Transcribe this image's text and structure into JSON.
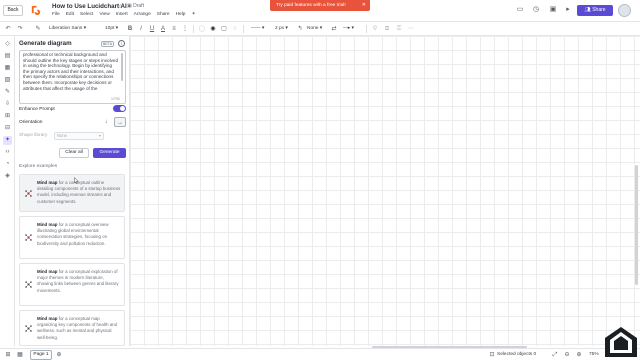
{
  "header": {
    "back_label": "Back",
    "doc_title": "How to Use Lucidchart AI",
    "draft_label": "Draft",
    "menu": [
      "File",
      "Edit",
      "Select",
      "View",
      "Insert",
      "Arrange",
      "Share",
      "Help"
    ],
    "trial_banner": "Try paid features with a free trial!",
    "share_label": "Share",
    "brand_color": "#5b4ad4",
    "banner_color": "#e8533c"
  },
  "toolbar": {
    "font_family": "Liberation Sans",
    "font_size": "10pt",
    "line_width": "2 px",
    "arrow_start": "None"
  },
  "panel": {
    "title": "Generate diagram",
    "badge": "BETA",
    "prompt_text": "professional or technical background and should outline the key stages or steps involved in using the technology. Begin by identifying the primary actors and their interactions, and then specify the relationships or connections between them. Incorporate key decisions or attributes that affect the usage of the",
    "char_count": "1/700",
    "enhance_label": "Enhance Prompt",
    "enhance_on": true,
    "orientation_label": "Orientation",
    "shape_library_label": "Shape library",
    "shape_library_value": "None",
    "clear_label": "Clear all",
    "generate_label": "Generate",
    "explore_label": "Explore examples",
    "examples": [
      {
        "type": "Mind map",
        "text": "for a conceptual outline detailing components of a startup business model, including revenue streams and customer segments."
      },
      {
        "type": "Mind map",
        "text": "for a conceptual overview illustrating global environmental conservation strategies, focusing on biodiversity and pollution reduction."
      },
      {
        "type": "Mind map",
        "text": "for a conceptual exploration of major themes in modern literature, showing links between genres and literary movements."
      },
      {
        "type": "Mind map",
        "text": "for a conceptual map organizing key components of health and wellness, such as mental and physical well-being."
      }
    ]
  },
  "bottombar": {
    "page_label": "Page 1",
    "selected_label": "Selected objects",
    "selected_count": "0",
    "zoom": "75%"
  }
}
